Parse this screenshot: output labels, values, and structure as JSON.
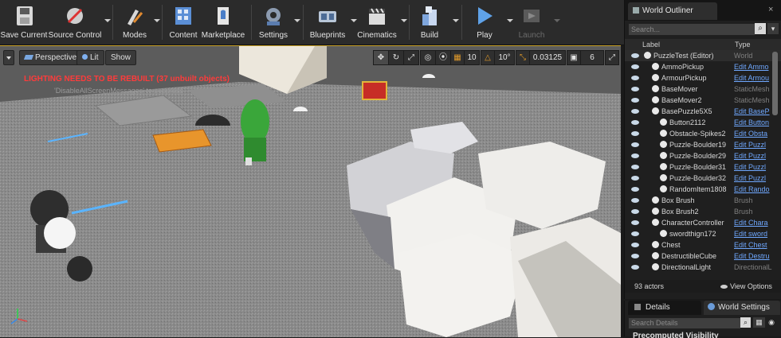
{
  "toolbar": {
    "buttons": [
      {
        "label": "Save Current",
        "icon": "save-icon"
      },
      {
        "label": "Source Control",
        "icon": "source-control-icon"
      },
      {
        "label": "Modes",
        "icon": "modes-icon"
      },
      {
        "label": "Content",
        "icon": "content-icon"
      },
      {
        "label": "Marketplace",
        "icon": "marketplace-icon"
      },
      {
        "label": "Settings",
        "icon": "settings-icon"
      },
      {
        "label": "Blueprints",
        "icon": "blueprints-icon"
      },
      {
        "label": "Cinematics",
        "icon": "cinematics-icon"
      },
      {
        "label": "Build",
        "icon": "build-icon"
      },
      {
        "label": "Play",
        "icon": "play-icon"
      },
      {
        "label": "Launch",
        "icon": "launch-icon"
      }
    ]
  },
  "viewport": {
    "perspective_label": "Perspective",
    "lit_label": "Lit",
    "show_label": "Show",
    "grid_snap": "10",
    "rotation_snap": "10°",
    "scale_snap": "0.03125",
    "camera_speed": "6",
    "warning": "LIGHTING NEEDS TO BE REBUILT (37 unbuilt objects)",
    "suppress_hint": "'DisableAllScreenMessages' to suppress"
  },
  "outliner": {
    "tab_title": "World Outliner",
    "search_placeholder": "Search...",
    "col_label": "Label",
    "col_type": "Type",
    "rows": [
      {
        "label": "PuzzleTest (Editor)",
        "type": "World",
        "indent": 0,
        "link": false
      },
      {
        "label": "AmmoPickup",
        "type": "Edit Ammo",
        "indent": 1,
        "link": true
      },
      {
        "label": "ArmourPickup",
        "type": "Edit Armou",
        "indent": 1,
        "link": true
      },
      {
        "label": "BaseMover",
        "type": "StaticMesh",
        "indent": 1,
        "link": false
      },
      {
        "label": "BaseMover2",
        "type": "StaticMesh",
        "indent": 1,
        "link": false
      },
      {
        "label": "BasePuzzle5X5",
        "type": "Edit BaseP",
        "indent": 1,
        "link": true
      },
      {
        "label": "Button2112",
        "type": "Edit Button",
        "indent": 2,
        "link": true
      },
      {
        "label": "Obstacle-Spikes2",
        "type": "Edit Obsta",
        "indent": 2,
        "link": true
      },
      {
        "label": "Puzzle-Boulder19",
        "type": "Edit Puzzl",
        "indent": 2,
        "link": true
      },
      {
        "label": "Puzzle-Boulder29",
        "type": "Edit Puzzl",
        "indent": 2,
        "link": true
      },
      {
        "label": "Puzzle-Boulder31",
        "type": "Edit Puzzl",
        "indent": 2,
        "link": true
      },
      {
        "label": "Puzzle-Boulder32",
        "type": "Edit Puzzl",
        "indent": 2,
        "link": true
      },
      {
        "label": "RandomItem1808",
        "type": "Edit Rando",
        "indent": 2,
        "link": true
      },
      {
        "label": "Box Brush",
        "type": "Brush",
        "indent": 1,
        "link": false
      },
      {
        "label": "Box Brush2",
        "type": "Brush",
        "indent": 1,
        "link": false
      },
      {
        "label": "CharacterController",
        "type": "Edit Chara",
        "indent": 1,
        "link": true
      },
      {
        "label": "swordthign172",
        "type": "Edit sword",
        "indent": 2,
        "link": true
      },
      {
        "label": "Chest",
        "type": "Edit Chest",
        "indent": 1,
        "link": true
      },
      {
        "label": "DestructibleCube",
        "type": "Edit Destru",
        "indent": 1,
        "link": true
      },
      {
        "label": "DirectionalLight",
        "type": "DirectionalL",
        "indent": 1,
        "link": false
      }
    ],
    "actor_count": "93 actors",
    "view_options": "View Options"
  },
  "details": {
    "tab_details": "Details",
    "tab_world_settings": "World Settings",
    "search_placeholder": "Search Details",
    "partial_header": "Precomputed Visibility"
  }
}
